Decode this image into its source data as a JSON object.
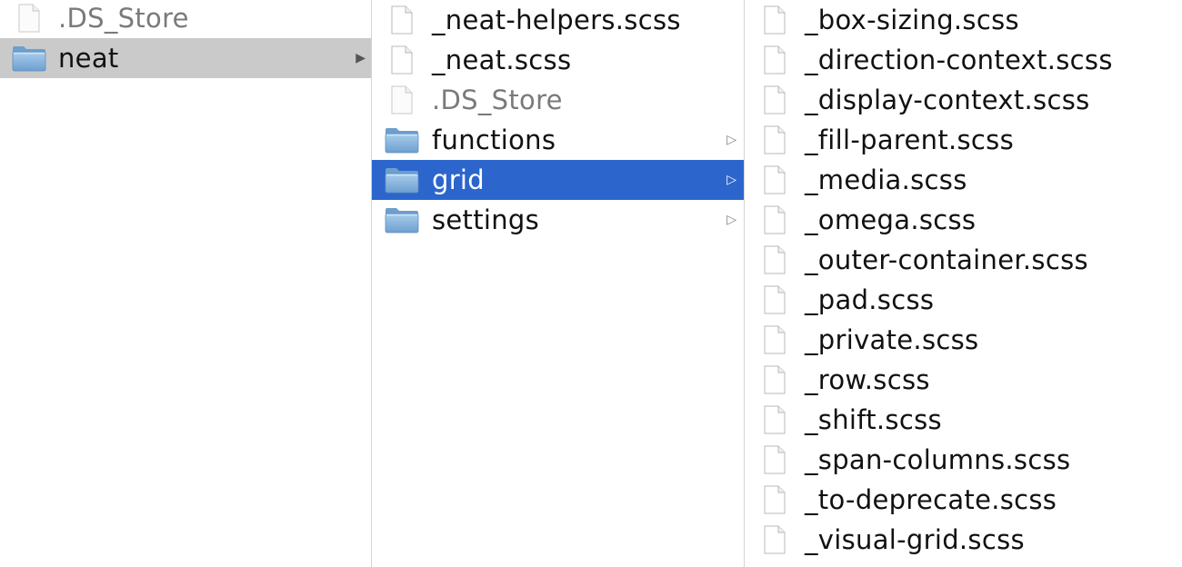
{
  "columns": [
    {
      "items": [
        {
          "type": "file",
          "label": ".DS_Store",
          "dim": true
        },
        {
          "type": "folder",
          "label": "neat",
          "has_children": true,
          "selected": "inactive"
        }
      ]
    },
    {
      "items": [
        {
          "type": "file",
          "label": "_neat-helpers.scss"
        },
        {
          "type": "file",
          "label": "_neat.scss"
        },
        {
          "type": "file",
          "label": ".DS_Store",
          "dim": true
        },
        {
          "type": "folder",
          "label": "functions",
          "has_children": true
        },
        {
          "type": "folder",
          "label": "grid",
          "has_children": true,
          "selected": "active"
        },
        {
          "type": "folder",
          "label": "settings",
          "has_children": true
        }
      ]
    },
    {
      "items": [
        {
          "type": "file",
          "label": "_box-sizing.scss"
        },
        {
          "type": "file",
          "label": "_direction-context.scss"
        },
        {
          "type": "file",
          "label": "_display-context.scss"
        },
        {
          "type": "file",
          "label": "_fill-parent.scss"
        },
        {
          "type": "file",
          "label": "_media.scss"
        },
        {
          "type": "file",
          "label": "_omega.scss"
        },
        {
          "type": "file",
          "label": "_outer-container.scss"
        },
        {
          "type": "file",
          "label": "_pad.scss"
        },
        {
          "type": "file",
          "label": "_private.scss"
        },
        {
          "type": "file",
          "label": "_row.scss"
        },
        {
          "type": "file",
          "label": "_shift.scss"
        },
        {
          "type": "file",
          "label": "_span-columns.scss"
        },
        {
          "type": "file",
          "label": "_to-deprecate.scss"
        },
        {
          "type": "file",
          "label": "_visual-grid.scss"
        }
      ]
    }
  ],
  "icons": {
    "file": "document-icon",
    "folder": "folder-icon",
    "expand": "disclosure-arrow-icon",
    "expand_glyph": "▶",
    "expand_glyph_active": "▷"
  },
  "colors": {
    "selection_active": "#2c66cc",
    "selection_inactive": "#cacaca",
    "folder_light": "#a9cdec",
    "folder_dark": "#6d9fcf"
  }
}
